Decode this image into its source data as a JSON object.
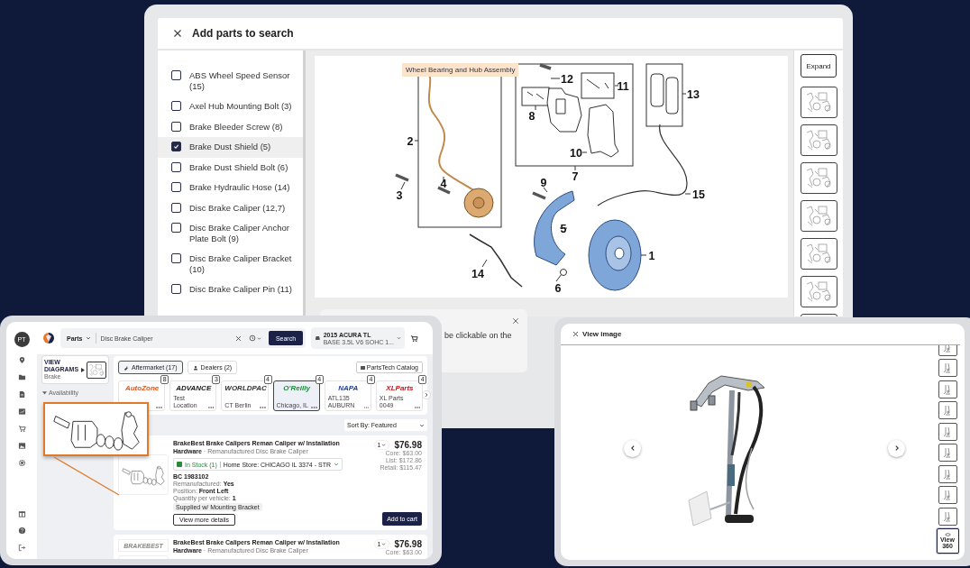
{
  "parts_dialog": {
    "title": "Add parts to search",
    "parts": [
      {
        "label": "ABS Wheel Speed Sensor (15)",
        "checked": false
      },
      {
        "label": "Axel Hub Mounting Bolt (3)",
        "checked": false
      },
      {
        "label": "Brake Bleeder Screw (8)",
        "checked": false
      },
      {
        "label": "Brake Dust Shield (5)",
        "checked": true
      },
      {
        "label": "Brake Dust Shield Bolt (6)",
        "checked": false
      },
      {
        "label": "Brake Hydraulic Hose (14)",
        "checked": false
      },
      {
        "label": "Disc Brake Caliper (12,7)",
        "checked": false
      },
      {
        "label": "Disc Brake Caliper Anchor Plate Bolt (9)",
        "checked": false
      },
      {
        "label": "Disc Brake Caliper Bracket (10)",
        "checked": false
      },
      {
        "label": "Disc Brake Caliper Pin (11)",
        "checked": false
      }
    ],
    "diagram": {
      "tooltip": "Wheel Bearing and Hub Assembly",
      "callouts": [
        "2",
        "3",
        "4",
        "12",
        "11",
        "8",
        "10",
        "7",
        "13",
        "9",
        "15",
        "5",
        "1",
        "14",
        "6"
      ]
    },
    "expand_button": "Expand",
    "notice": "be clickable on the"
  },
  "parts_search": {
    "avatar": "PT",
    "category": "Parts",
    "query": "Disc Brake Caliper",
    "search_button": "Search",
    "vehicle": {
      "model": "2015 ACURA TL",
      "engine": "BASE 3.5L V6 SOHC 1..."
    },
    "view_diagrams": {
      "title": "VIEW DIAGRAMS",
      "subtitle": "Brake"
    },
    "filter_heading": "Availability",
    "source_tabs": [
      {
        "label": "Aftermarket (17)",
        "selected": true
      },
      {
        "label": "Dealers (2)",
        "selected": false
      }
    ],
    "catalog_button": "PartsTech Catalog",
    "stores": [
      {
        "logo": "AutoZone",
        "count": "8",
        "color": "#e2561c",
        "selected": false
      },
      {
        "logo": "ADVANCE",
        "name": "Test Location",
        "count": "3",
        "color": "#1a1a1a",
        "selected": false
      },
      {
        "logo": "WORLDPAC",
        "name": "CT Berlin",
        "count": "4",
        "color": "#333333",
        "selected": false
      },
      {
        "logo": "O'Reilly",
        "name": "Chicago, IL",
        "count": "4",
        "color": "#1f8a3b",
        "selected": true
      },
      {
        "logo": "NAPA",
        "name": "ATL135 AUBURN",
        "count": "4",
        "color": "#1f3f99",
        "selected": false
      },
      {
        "logo": "XLParts",
        "name": "XL Parts 0049",
        "count": "4",
        "color": "#c4161c",
        "selected": false
      }
    ],
    "sort": "Sort By: Featured",
    "products": [
      {
        "title": "**BrakeBest Brake Calipers Reman Caliper w/ Installation Hardware** · Remanufactured Disc Brake Caliper",
        "quantity": "1",
        "price": "$76.98",
        "price_details": [
          "Core: $63.00",
          "List: $172.86",
          "Retail: $115.47"
        ],
        "stock": "In Stock (1)",
        "store": "Home Store: CHICAGO IL 3374 - STR",
        "part_number": "BC 1983102",
        "specs": [
          "Remanufactured: **Yes**",
          "Position: **Front Left**",
          "Quantity per vehicle: **1**"
        ],
        "tag": "Supplied w/ Mounting Bracket",
        "details_button": "View more details",
        "cart_button": "Add to cart"
      },
      {
        "brand": "BRAKEBEST",
        "title": "**BrakeBest Brake Calipers Reman Caliper w/ Installation Hardware** · Remanufactured Disc Brake Caliper",
        "quantity": "1",
        "price": "$76.98",
        "price_details": [
          "Core: $63.00"
        ]
      }
    ]
  },
  "image_viewer": {
    "title": "View image",
    "thumbnails": [
      {
        "selected": false
      },
      {
        "selected": false
      },
      {
        "selected": false
      },
      {
        "selected": false
      },
      {
        "selected": false
      },
      {
        "selected": false
      },
      {
        "selected": false
      },
      {
        "selected": false
      },
      {
        "selected": false
      },
      {
        "label": "View 360",
        "selected": true
      }
    ]
  }
}
